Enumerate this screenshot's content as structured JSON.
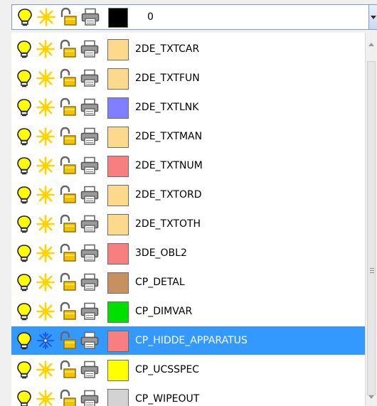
{
  "combo": {
    "label": "0",
    "color": "#000000",
    "icons": [
      "lightbulb-on-icon",
      "sun-thawed-icon",
      "unlocked-icon",
      "printer-icon"
    ]
  },
  "layers": [
    {
      "name": "2DE_TXTCAR",
      "color": "#fcd98c",
      "selected": false,
      "frozen": false
    },
    {
      "name": "2DE_TXTFUN",
      "color": "#fcd98c",
      "selected": false,
      "frozen": false
    },
    {
      "name": "2DE_TXTLNK",
      "color": "#7f7fff",
      "selected": false,
      "frozen": false
    },
    {
      "name": "2DE_TXTMAN",
      "color": "#fcd98c",
      "selected": false,
      "frozen": false
    },
    {
      "name": "2DE_TXTNUM",
      "color": "#f87f7f",
      "selected": false,
      "frozen": false
    },
    {
      "name": "2DE_TXTORD",
      "color": "#fcd98c",
      "selected": false,
      "frozen": false
    },
    {
      "name": "2DE_TXTOTH",
      "color": "#fcd98c",
      "selected": false,
      "frozen": false
    },
    {
      "name": "3DE_OBL2",
      "color": "#f87f7f",
      "selected": false,
      "frozen": false
    },
    {
      "name": "CP_DETAL",
      "color": "#c7905f",
      "selected": false,
      "frozen": false
    },
    {
      "name": "CP_DIMVAR",
      "color": "#00e000",
      "selected": false,
      "frozen": false
    },
    {
      "name": "CP_HIDDE_APPARATUS",
      "color": "#f87f7f",
      "selected": true,
      "frozen": true
    },
    {
      "name": "CP_UCSSPEC",
      "color": "#ffff00",
      "selected": false,
      "frozen": false
    },
    {
      "name": "CP_WIPEOUT",
      "color": "#d3d3d3",
      "selected": false,
      "frozen": false
    }
  ],
  "colors": {
    "selection": "#3399ff",
    "bulb": "#ffff00",
    "sun": "#ffd400",
    "snowflake": "#1f5fd6",
    "lock": "#f2c300",
    "printer": "#777777"
  }
}
